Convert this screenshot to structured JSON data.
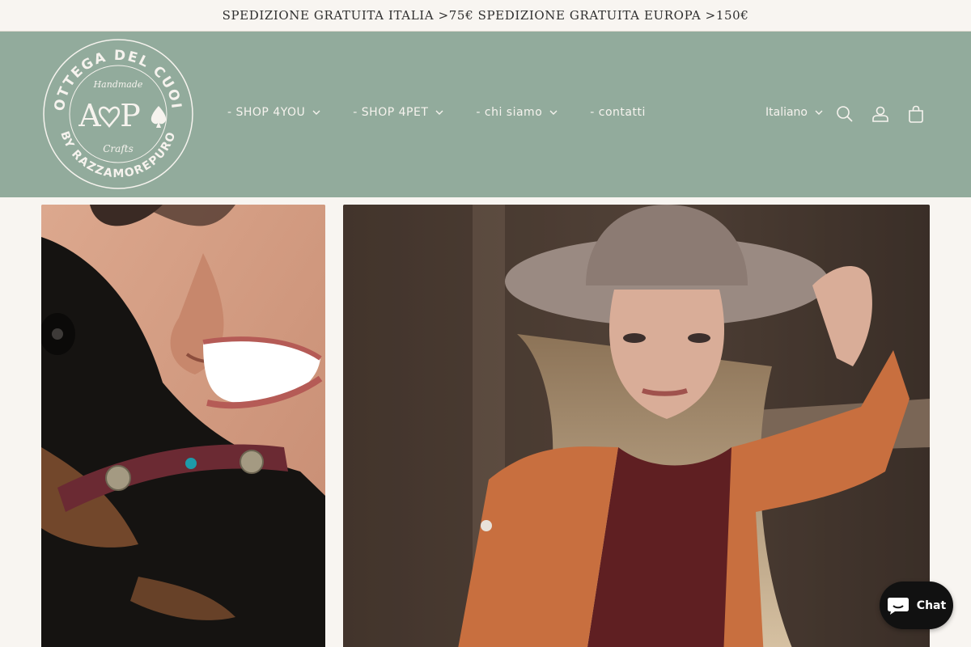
{
  "announcement": "SPEDIZIONE GRATUITA ITALIA >75€ SPEDIZIONE GRATUITA EUROPA >150€",
  "logo": {
    "top_text": "BOTTEGA DEL CUOIO",
    "bottom_text": "BY RAZZAMOREPURO",
    "script_top": "Handmade",
    "script_bottom": "Crafts",
    "monogram_a": "A",
    "monogram_p": "P"
  },
  "nav": {
    "items": [
      {
        "label": "- SHOP 4YOU"
      },
      {
        "label": "- SHOP 4PET"
      },
      {
        "label": "- chi siamo"
      },
      {
        "label": "- contatti"
      }
    ]
  },
  "header": {
    "language": "Italiano",
    "icons": [
      "search-icon",
      "account-icon",
      "cart-icon"
    ]
  },
  "images": {
    "left": "woman-with-dog-photo",
    "right": "woman-in-hat-photo"
  },
  "chat": {
    "label": "Chat"
  },
  "colors": {
    "header_bg": "#92ab9c",
    "page_bg": "#f8f5f1",
    "nav_text": "#f6f3ee"
  }
}
